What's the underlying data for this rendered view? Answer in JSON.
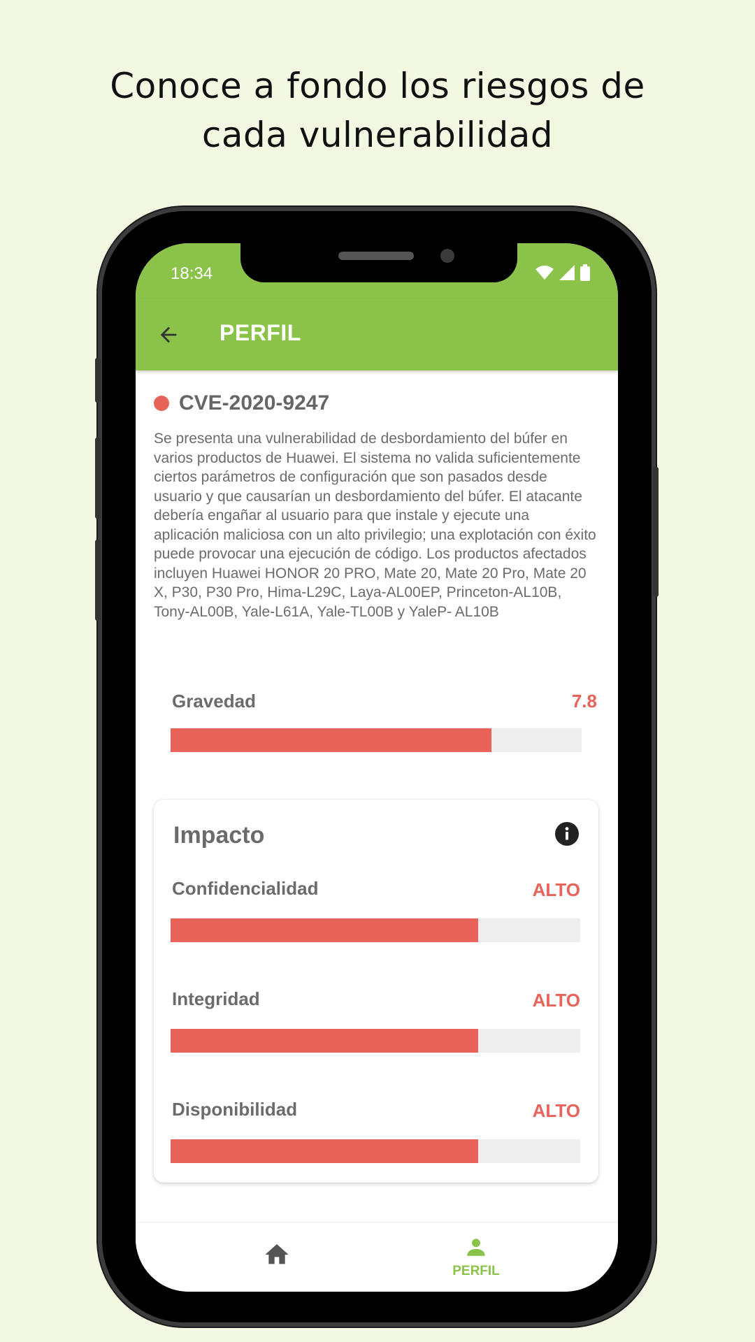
{
  "headline": {
    "line1": "Conoce a fondo los riesgos de",
    "line2": "cada vulnerabilidad"
  },
  "status_bar": {
    "time": "18:34"
  },
  "app_bar": {
    "title": "PERFIL"
  },
  "vulnerability": {
    "id": "CVE-2020-9247",
    "description": "Se presenta una vulnerabilidad de desbordamiento del búfer en varios productos de Huawei. El sistema no valida suficientemente ciertos parámetros de configuración que son pasados desde usuario y que causarían un desbordamiento del búfer. El atacante debería engañar al usuario para que instale y ejecute una aplicación maliciosa con un alto privilegio; una explotación con éxito puede provocar una ejecución de código. Los productos afectados incluyen Huawei HONOR 20 PRO, Mate 20, Mate 20 Pro, Mate 20 X, P30, P30 Pro, Hima-L29C, Laya-AL00EP, Princeton-AL10B, Tony-AL00B, Yale-L61A, Yale-TL00B y YaleP- AL10B"
  },
  "severity": {
    "label": "Gravedad",
    "value": "7.8",
    "fraction": 0.78
  },
  "impact": {
    "title": "Impacto",
    "items": [
      {
        "label": "Confidencialidad",
        "value": "ALTO",
        "fraction": 0.75
      },
      {
        "label": "Integridad",
        "value": "ALTO",
        "fraction": 0.75
      },
      {
        "label": "Disponibilidad",
        "value": "ALTO",
        "fraction": 0.75
      }
    ]
  },
  "bottom_nav": {
    "profile_label": "PERFIL"
  },
  "colors": {
    "brand": "#8bc34a",
    "danger": "#e8635a",
    "background": "#f2f8e1"
  }
}
